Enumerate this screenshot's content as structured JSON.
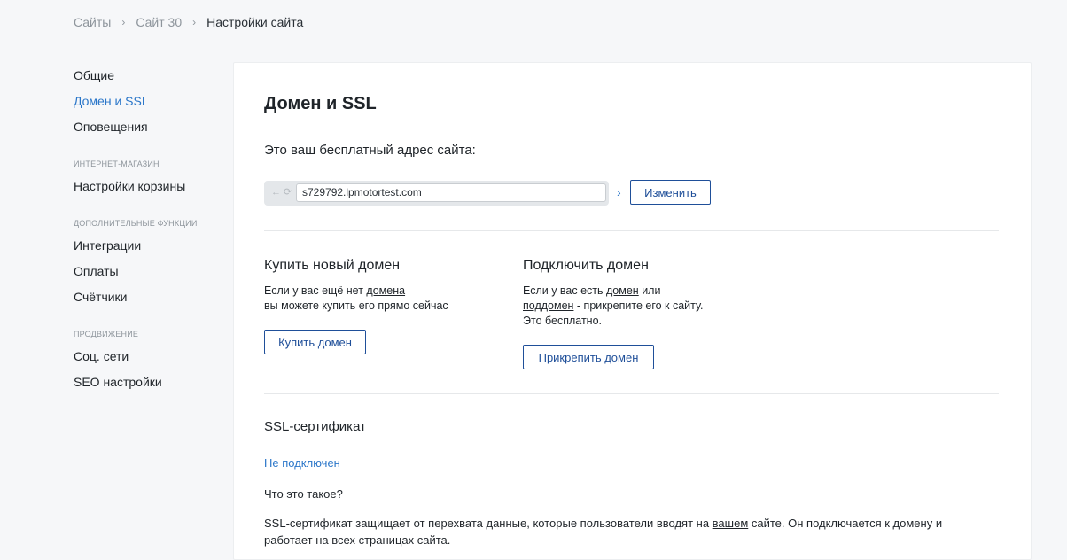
{
  "breadcrumb": {
    "items": [
      "Сайты",
      "Сайт 30"
    ],
    "current": "Настройки сайта",
    "separator": "›"
  },
  "sidebar": {
    "group1": [
      "Общие",
      "Домен и SSL",
      "Оповещения"
    ],
    "section_shop": "Интернет-магазин",
    "group2": [
      "Настройки корзины"
    ],
    "section_extra": "Дополнительные функции",
    "group3": [
      "Интеграции",
      "Оплаты",
      "Счётчики"
    ],
    "section_promo": "Продвижение",
    "group4": [
      "Соц. сети",
      "SEO настройки"
    ]
  },
  "main": {
    "title": "Домен и SSL",
    "free_address_label": "Это ваш бесплатный адрес сайта:",
    "url": "s729792.lpmotortest.com",
    "change_button": "Изменить",
    "buy": {
      "title": "Купить новый домен",
      "line1_prefix": "Если у вас ещё нет ",
      "line1_link": "домена",
      "line2": "вы можете купить его прямо сейчас",
      "button": "Купить домен"
    },
    "connect": {
      "title": "Подключить домен",
      "line1_prefix": "Если у вас есть ",
      "line1_link": "домен",
      "line1_suffix": " или",
      "line2_link": "поддомен",
      "line2_suffix": " - прикрепите его к сайту.",
      "line3": "Это бесплатно.",
      "button": "Прикрепить домен"
    },
    "ssl": {
      "title": "SSL-сертификат",
      "status": "Не подключен",
      "question": "Что это такое?",
      "desc_prefix": "SSL-сертификат защищает от перехвата данные, которые пользователи вводят на ",
      "desc_link": "вашем",
      "desc_suffix": " сайте. Он подключается к домену и работает на всех страницах сайта."
    }
  },
  "colors": {
    "accent": "#2a76c9",
    "button": "#1f4f99"
  }
}
